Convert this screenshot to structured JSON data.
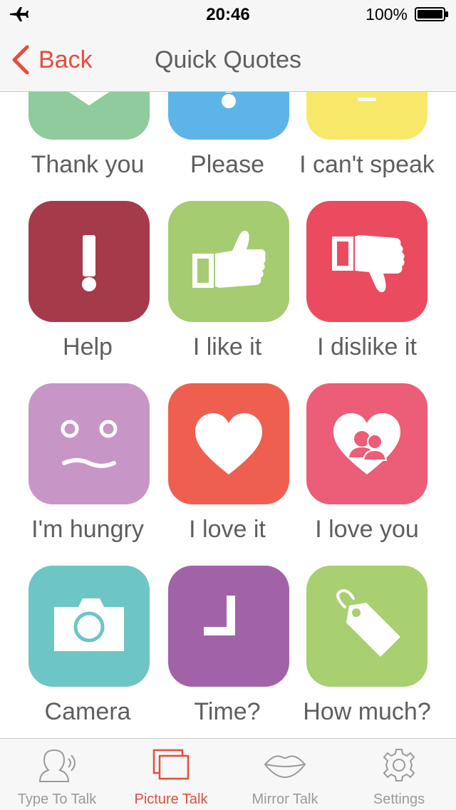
{
  "status_bar": {
    "time": "20:46",
    "battery": "100%"
  },
  "nav": {
    "back_label": "Back",
    "title": "Quick Quotes"
  },
  "colors": {
    "accent": "#e74c3c"
  },
  "tiles": [
    {
      "label": "Thank you",
      "color": "#8fcb9b",
      "icon": "chevron-down-icon"
    },
    {
      "label": "Please",
      "color": "#5db4e8",
      "icon": "exclamation-dot-icon"
    },
    {
      "label": "I can't speak",
      "color": "#f8e86a",
      "icon": "dash-icon"
    },
    {
      "label": "Help",
      "color": "#a53a4a",
      "icon": "exclamation-icon"
    },
    {
      "label": "I like it",
      "color": "#a6cc72",
      "icon": "thumbs-up-icon"
    },
    {
      "label": "I dislike it",
      "color": "#eb4b5f",
      "icon": "thumbs-down-icon"
    },
    {
      "label": "I'm hungry",
      "color": "#c896c6",
      "icon": "wavy-face-icon"
    },
    {
      "label": "I love it",
      "color": "#ee5f4f",
      "icon": "heart-icon"
    },
    {
      "label": "I love you",
      "color": "#ec5d78",
      "icon": "heart-couple-icon"
    },
    {
      "label": "Camera",
      "color": "#6ec5c5",
      "icon": "camera-icon"
    },
    {
      "label": "Time?",
      "color": "#a262a8",
      "icon": "clock-icon"
    },
    {
      "label": "How much?",
      "color": "#a8cf70",
      "icon": "price-tag-icon"
    }
  ],
  "tabs": [
    {
      "label": "Type To Talk",
      "icon": "speaking-head-icon",
      "active": false
    },
    {
      "label": "Picture Talk",
      "icon": "pictures-icon",
      "active": true
    },
    {
      "label": "Mirror Talk",
      "icon": "lips-icon",
      "active": false
    },
    {
      "label": "Settings",
      "icon": "gear-icon",
      "active": false
    }
  ]
}
